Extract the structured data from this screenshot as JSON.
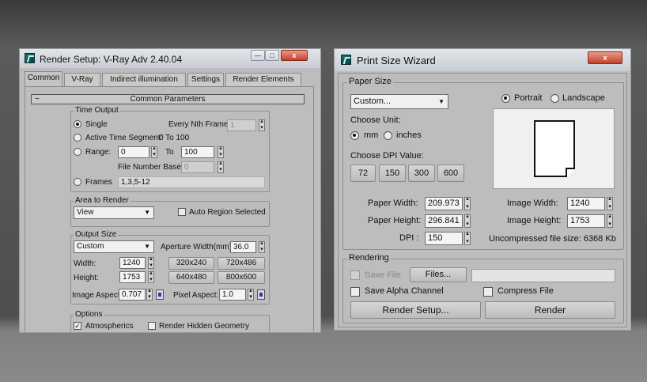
{
  "render_setup": {
    "title": "Render Setup: V-Ray Adv 2.40.04",
    "caption_buttons": [
      "—",
      "□",
      "x"
    ],
    "tabs": [
      "Common",
      "V-Ray",
      "Indirect illumination",
      "Settings",
      "Render Elements"
    ],
    "rollout": {
      "toggle": "−",
      "title": "Common Parameters"
    },
    "time_output": {
      "label": "Time Output",
      "single": "Single",
      "every_nth_label": "Every Nth Frame:",
      "every_nth_value": "1",
      "active_segment": "Active Time Segment:",
      "active_segment_value": "0 To 100",
      "range": "Range:",
      "range_from": "0",
      "to": "To",
      "range_to": "100",
      "file_number_base": "File Number Base:",
      "file_number_base_value": "0",
      "frames": "Frames",
      "frames_value": "1,3,5-12"
    },
    "area_to_render": {
      "label": "Area to Render",
      "selected": "View",
      "auto_region": "Auto Region Selected"
    },
    "output_size": {
      "label": "Output Size",
      "preset": "Custom",
      "aperture_label": "Aperture Width(mm):",
      "aperture_value": "36.0",
      "width_label": "Width:",
      "width_value": "1240",
      "height_label": "Height:",
      "height_value": "1753",
      "presets": [
        "320x240",
        "720x486",
        "640x480",
        "800x600"
      ],
      "image_aspect_label": "Image Aspect:",
      "image_aspect_value": "0.707",
      "pixel_aspect_label": "Pixel Aspect:",
      "pixel_aspect_value": "1.0"
    },
    "options": {
      "label": "Options",
      "atmospherics": "Atmospherics",
      "render_hidden": "Render Hidden Geometry"
    }
  },
  "print_wizard": {
    "title": "Print Size Wizard",
    "close": "x",
    "paper_size": {
      "label": "Paper Size",
      "preset": "Custom...",
      "portrait": "Portrait",
      "landscape": "Landscape",
      "choose_unit": "Choose Unit:",
      "mm": "mm",
      "inches": "inches",
      "choose_dpi": "Choose DPI Value:",
      "dpi_buttons": [
        "72",
        "150",
        "300",
        "600"
      ],
      "paper_width_label": "Paper Width:",
      "paper_width_value": "209.973",
      "paper_height_label": "Paper Height:",
      "paper_height_value": "296.841",
      "dpi_label": "DPI :",
      "dpi_value": "150",
      "image_width_label": "Image Width:",
      "image_width_value": "1240",
      "image_height_label": "Image Height:",
      "image_height_value": "1753",
      "uncompressed": "Uncompressed file size: 6368 Kb"
    },
    "rendering": {
      "label": "Rendering",
      "save_file": "Save File",
      "files_button": "Files...",
      "file_path": "",
      "save_alpha": "Save Alpha Channel",
      "compress_file": "Compress File",
      "render_setup_button": "Render Setup...",
      "render_button": "Render"
    }
  },
  "colors": {
    "window_bg": "#bdbdbd",
    "close_button": "#c4422c"
  }
}
